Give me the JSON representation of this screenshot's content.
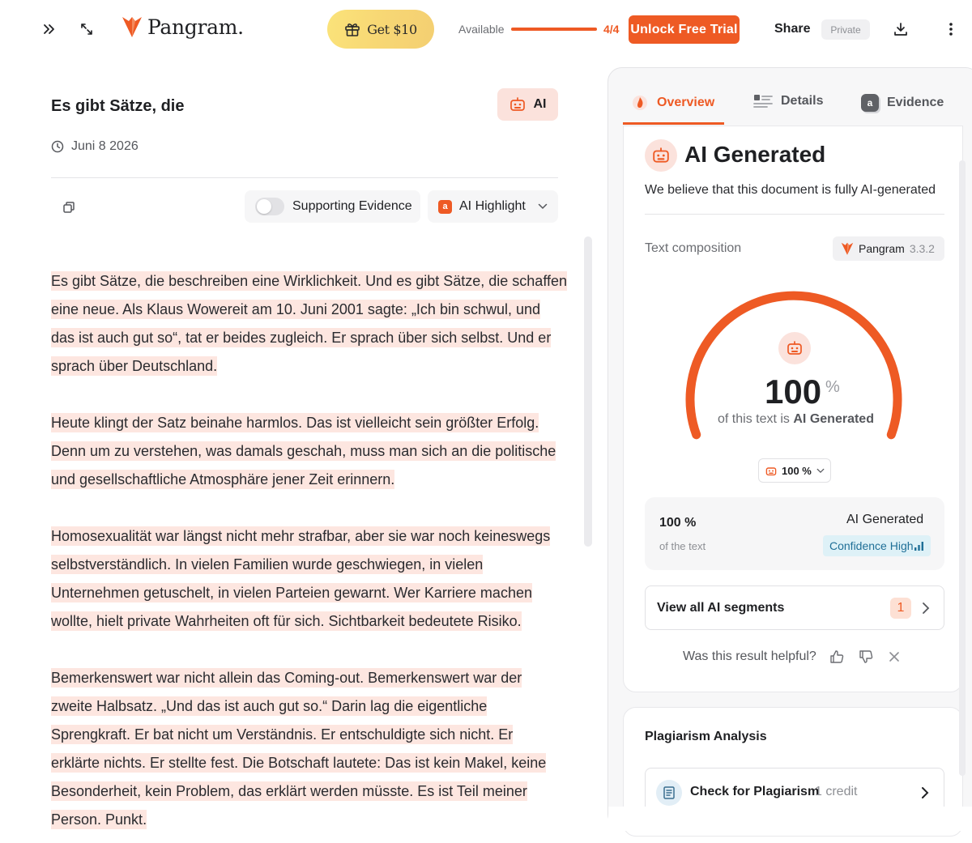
{
  "topbar": {
    "logo_text": "Pangram.",
    "get_label": "Get $10",
    "available_label": "Available",
    "available_fraction": 1.0,
    "available_count": "4/4",
    "unlock_label": "Unlock Free Trial",
    "share_label": "Share",
    "private_label": "Private"
  },
  "document": {
    "title": "Es gibt Sätze, die",
    "ai_tag": "AI",
    "date": "Juni 8 2026",
    "supporting_evidence": "Supporting Evidence",
    "ai_highlight": "AI Highlight",
    "ai_highlight_badge": "a",
    "paragraphs": [
      [
        "Es gibt Sätze, die beschreiben eine Wirklichkeit. Und es gibt Sätze, die schaffen",
        "eine neue. Als Klaus Wowereit am 10. Juni 2001 sagte: „Ich bin schwul, und",
        "das ist auch gut so“, tat er beides zugleich. Er sprach über sich selbst. Und er",
        "sprach über Deutschland."
      ],
      [
        "Heute klingt der Satz beinahe harmlos. Das ist vielleicht sein größter Erfolg.",
        "Denn um zu verstehen, was damals geschah, muss man sich an die politische",
        "und gesellschaftliche Atmosphäre jener Zeit erinnern."
      ],
      [
        "Homosexualität war längst nicht mehr strafbar, aber sie war noch keineswegs",
        "selbstverständlich. In vielen Familien wurde geschwiegen, in vielen",
        "Unternehmen getuschelt, in vielen Parteien gewarnt. Wer Karriere machen",
        "wollte, hielt private Wahrheiten oft für sich. Sichtbarkeit bedeutete Risiko."
      ],
      [
        "Bemerkenswert war nicht allein das Coming-out. Bemerkenswert war der",
        "zweite Halbsatz. „Und das ist auch gut so.“ Darin lag die eigentliche",
        "Sprengkraft. Er bat nicht um Verständnis. Er entschuldigte sich nicht. Er",
        "erklärte nichts. Er stellte fest. Die Botschaft lautete: Das ist kein Makel, keine",
        "Besonderheit, kein Problem, das erklärt werden müsste. Es ist Teil meiner",
        "Person. Punkt."
      ]
    ]
  },
  "panel": {
    "tabs": [
      "Overview",
      "Details",
      "Evidence"
    ],
    "evidence_badge": "a",
    "result_title": "AI Generated",
    "result_sub": "We believe that this document is fully AI-generated",
    "composition_label": "Text composition",
    "model_name": "Pangram",
    "model_version": "3.3.2",
    "gauge_value": "100",
    "gauge_fraction": 1.0,
    "gauge_pct_sign": "%",
    "gauge_sub_prefix": "of this text is",
    "gauge_sub_bold": "AI Generated",
    "pct_select": "100 %",
    "stat_pct": "100 %",
    "stat_of": "of the text",
    "stat_label": "AI Generated",
    "confidence": "Confidence High",
    "segments_label": "View all AI segments",
    "segments_count": "1",
    "helpful_label": "Was this result helpful?",
    "plagiarism_title": "Plagiarism Analysis",
    "plagiarism_button": "Check for Plagiarism",
    "plagiarism_credit": "1 credit"
  },
  "colors": {
    "accent": "#ee5a24",
    "highlight": "#fde6e0",
    "ai_tag_bg": "#fbe2dc",
    "confidence_bg": "#def1f7"
  }
}
